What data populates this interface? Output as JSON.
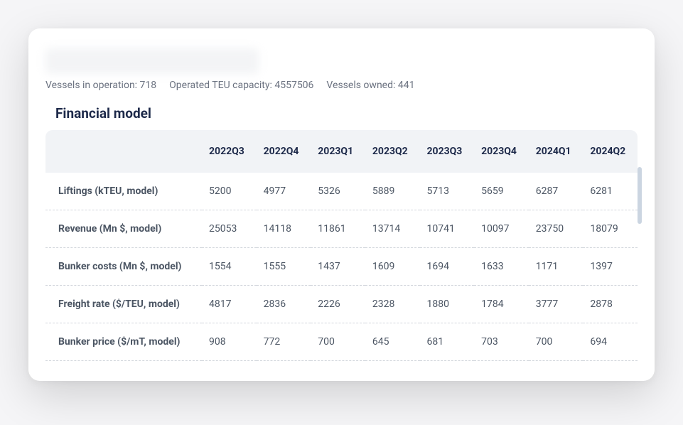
{
  "meta": {
    "vessels_in_operation_label": "Vessels in operation: ",
    "vessels_in_operation_value": "718",
    "operated_teu_label": "Operated TEU capacity: ",
    "operated_teu_value": "4557506",
    "vessels_owned_label": "Vessels owned: ",
    "vessels_owned_value": "441"
  },
  "section_title": "Financial model",
  "chart_data": {
    "type": "table",
    "columns": [
      "2022Q3",
      "2022Q4",
      "2023Q1",
      "2023Q2",
      "2023Q3",
      "2023Q4",
      "2024Q1",
      "2024Q2"
    ],
    "rows": [
      {
        "label": "Liftings (kTEU, model)",
        "values": [
          5200,
          4977,
          5326,
          5889,
          5713,
          5659,
          6287,
          6281
        ]
      },
      {
        "label": "Revenue (Mn $, model)",
        "values": [
          25053,
          14118,
          11861,
          13714,
          10741,
          10097,
          23750,
          18079
        ]
      },
      {
        "label": "Bunker costs (Mn $, model)",
        "values": [
          1554,
          1555,
          1437,
          1609,
          1694,
          1633,
          1171,
          1397
        ]
      },
      {
        "label": "Freight rate ($/TEU, model)",
        "values": [
          4817,
          2836,
          2226,
          2328,
          1880,
          1784,
          3777,
          2878
        ]
      },
      {
        "label": "Bunker price ($/mT, model)",
        "values": [
          908,
          772,
          700,
          645,
          681,
          703,
          700,
          694
        ]
      }
    ]
  }
}
